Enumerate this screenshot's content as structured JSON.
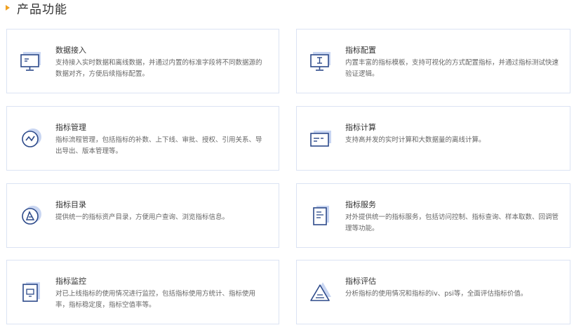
{
  "section": {
    "title": "产品功能"
  },
  "colors": {
    "accent": "#f0a020",
    "card_border": "#dbe3f3",
    "icon_dark": "#2d4a8a",
    "icon_light": "#c9d6f2"
  },
  "features": [
    {
      "icon": "monitor-icon",
      "title": "数据接入",
      "desc": "支持接入实时数据和离线数据，并通过内置的标准字段将不同数据源的数据对齐，方便后续指标配置。"
    },
    {
      "icon": "config-monitor-icon",
      "title": "指标配置",
      "desc": "内置丰富的指标模板，支持可视化的方式配置指标，并通过指标测试快速验证逻辑。"
    },
    {
      "icon": "trend-circle-icon",
      "title": "指标管理",
      "desc": "指标流程管理，包括指标的补数、上下线、审批、授权、引用关系、导出导出、版本管理等。"
    },
    {
      "icon": "calculator-icon",
      "title": "指标计算",
      "desc": "支持高并发的实时计算和大数据量的离线计算。"
    },
    {
      "icon": "catalog-icon",
      "title": "指标目录",
      "desc": "提供统一的指标资产目录，方便用户查询、浏览指标信息。"
    },
    {
      "icon": "document-icon",
      "title": "指标服务",
      "desc": "对外提供统一的指标服务，包括访问控制、指标查询、样本取数、回调管理等功能。"
    },
    {
      "icon": "monitor-square-icon",
      "title": "指标监控",
      "desc": "对已上线指标的使用情况进行监控，包括指标使用方统计、指标使用率，指标稳定度，指标空值率等。"
    },
    {
      "icon": "warning-triangle-icon",
      "title": "指标评估",
      "desc": "分析指标的使用情况和指标的iv、psi等，全面评估指标价值。"
    }
  ]
}
